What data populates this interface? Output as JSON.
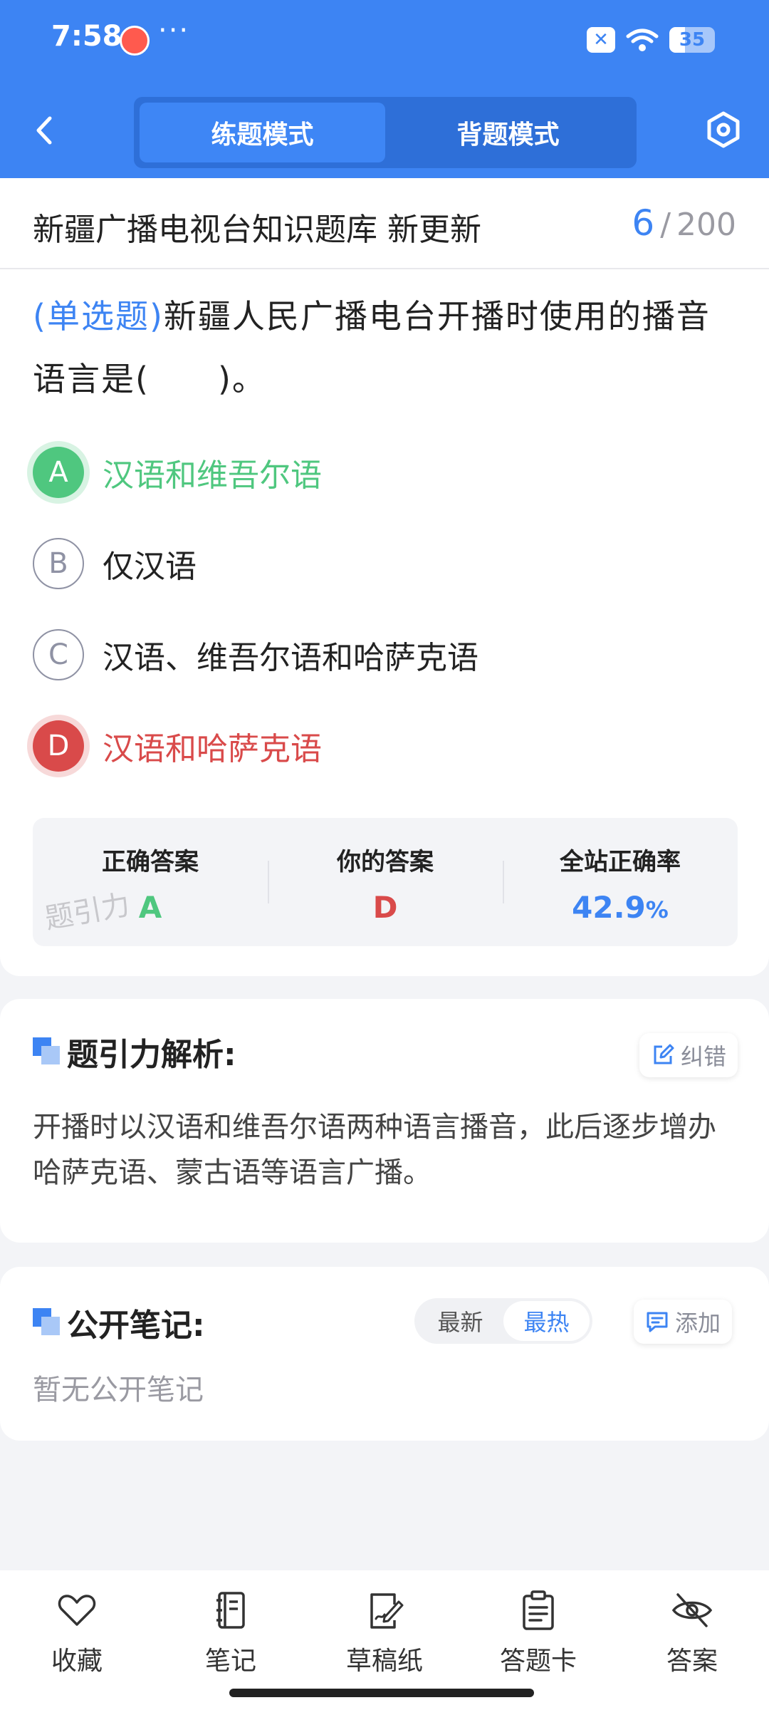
{
  "status_bar": {
    "time": "7:58",
    "dots": "···",
    "battery": "35",
    "battery_level": 0.35
  },
  "nav": {
    "modes": [
      "练题模式",
      "背题模式"
    ],
    "active_mode": "练题模式"
  },
  "bank": {
    "title": "新疆广播电视台知识题库 新更新",
    "current": "6",
    "separator": "/",
    "total": "200"
  },
  "question": {
    "type_label": "(单选题)",
    "text": "新疆人民广播电台开播时使用的播音语言是(　　)。"
  },
  "options": [
    {
      "letter": "A",
      "text": "汉语和维吾尔语",
      "state": "correct"
    },
    {
      "letter": "B",
      "text": "仅汉语",
      "state": "normal"
    },
    {
      "letter": "C",
      "text": "汉语、维吾尔语和哈萨克语",
      "state": "normal"
    },
    {
      "letter": "D",
      "text": "汉语和哈萨克语",
      "state": "wrong"
    }
  ],
  "stats": {
    "correct_label": "正确答案",
    "correct_value": "A",
    "yours_label": "你的答案",
    "yours_value": "D",
    "rate_label": "全站正确率",
    "rate_value": "42.9",
    "rate_unit": "%",
    "watermark": "题引力"
  },
  "analysis": {
    "title": "题引力解析:",
    "report_label": "纠错",
    "text": "开播时以汉语和维吾尔语两种语言播音，此后逐步增办哈萨克语、蒙古语等语言广播。"
  },
  "notes": {
    "title": "公开笔记:",
    "sort_options": [
      "最新",
      "最热"
    ],
    "active_sort": "最热",
    "add_label": "添加",
    "empty_text": "暂无公开笔记"
  },
  "bottom_tabs": [
    {
      "label": "收藏",
      "icon": "heart-icon"
    },
    {
      "label": "笔记",
      "icon": "notebook-icon"
    },
    {
      "label": "草稿纸",
      "icon": "draft-icon"
    },
    {
      "label": "答题卡",
      "icon": "clipboard-icon"
    },
    {
      "label": "答案",
      "icon": "eye-off-icon"
    }
  ],
  "colors": {
    "primary": "#3d84f3",
    "correct": "#4fc77f",
    "wrong": "#d94a4a"
  }
}
